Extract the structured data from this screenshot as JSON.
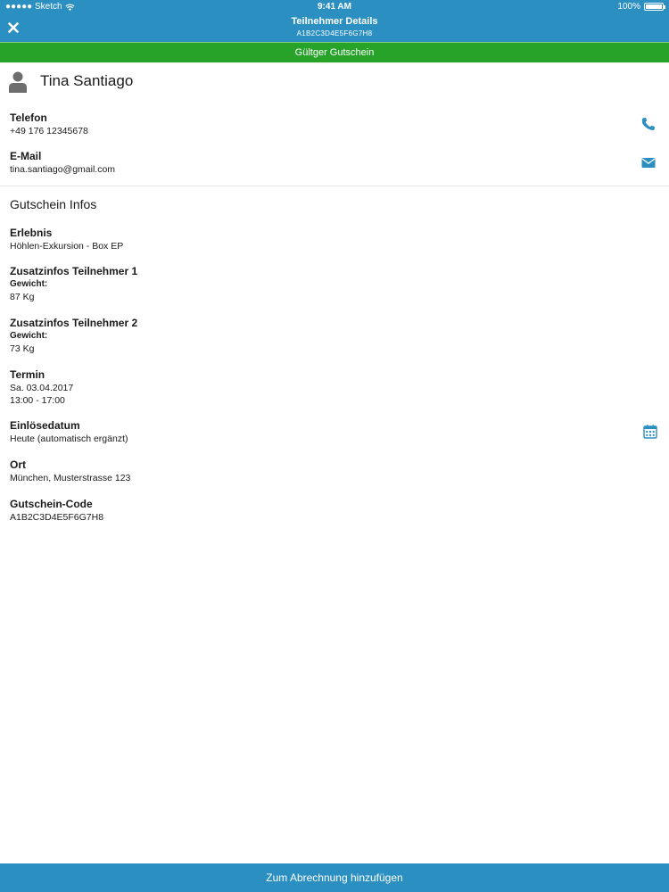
{
  "status_bar": {
    "carrier": "●●●●● Sketch",
    "time": "9:41 AM",
    "battery": "100%"
  },
  "nav": {
    "title": "Teilnehmer Details",
    "subtitle": "A1B2C3D4E5F6G7H8"
  },
  "banner": {
    "text": "Gültger Gutschein"
  },
  "contact": {
    "name": "Tina Santiago",
    "phone_label": "Telefon",
    "phone_value": "+49 176 12345678",
    "email_label": "E-Mail",
    "email_value": "tina.santiago@gmail.com"
  },
  "voucher": {
    "section_title": "Gutschein Infos",
    "experience_label": "Erlebnis",
    "experience_value": "Höhlen-Exkursion - Box EP",
    "extra1_label": "Zusatzinfos Teilnehmer 1",
    "extra1_sublabel": "Gewicht:",
    "extra1_value": "87 Kg",
    "extra2_label": "Zusatzinfos Teilnehmer 2",
    "extra2_sublabel": "Gewicht:",
    "extra2_value": "73 Kg",
    "date_label": "Termin",
    "date_value": "Sa. 03.04.2017",
    "time_value": "13:00 - 17:00",
    "redeem_label": "Einlösedatum",
    "redeem_value": "Heute (automatisch ergänzt)",
    "place_label": "Ort",
    "place_value": "München, Musterstrasse 123",
    "code_label": "Gutschein-Code",
    "code_value": "A1B2C3D4E5F6G7H8"
  },
  "footer": {
    "button_label": "Zum Abrechnung hinzufügen"
  },
  "colors": {
    "primary": "#2b8fc2",
    "success": "#28a32a",
    "icon": "#2b8fc2"
  },
  "icons": {
    "close": "close-icon",
    "avatar": "person-icon",
    "phone": "phone-icon",
    "email": "envelope-icon",
    "calendar": "calendar-icon",
    "wifi": "wifi-icon",
    "battery": "battery-icon"
  }
}
